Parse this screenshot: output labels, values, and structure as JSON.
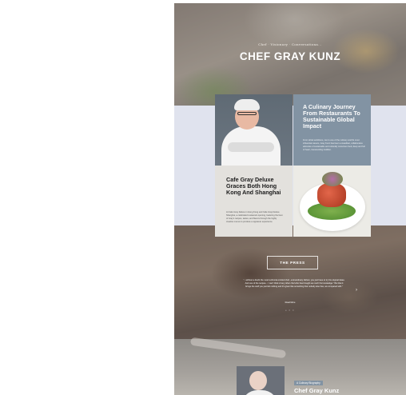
{
  "hero": {
    "tagline": "Chef · Visionary · Conversationa...",
    "title": "CHEF GRAY KUNZ"
  },
  "features": {
    "journey": {
      "title": "A Culinary Journey From Restaurants To Sustainable Global Impact",
      "body": "From whisk ambitions, can to one of the culinary world's most influential careers, Gray Kunz has been a steadfast, collaborative advocate of sustainable and culturally conscious food, deep and full of heart, transcending tradition."
    },
    "cafe": {
      "title": "Cafe Gray Deluxe Graces Both Hong Kong And Shanghai",
      "body": "At Cafe Gray Deluxe in Hong Kong and Cafe Gray Deluxe Shanghai, a celebrated restaurant opening, featuring the best of Gray's recipes, tastes, and flavors through the highly creative menus to produce a signature experience."
    }
  },
  "press": {
    "button_label": "THE PRESS",
    "quote": "\"...without a doubt the most technical-minded chef...extraordinary dishes; you just have to try his original ideas. And one of the recipes... I can't think of any other chef who has brought as much his knowledge.\" But that it brings the stuff you just felt nothing and it's given like something that nobody else has, we compared with.\"",
    "read_more": "Read More",
    "dots": "• ○ ○"
  },
  "bottom": {
    "label": "A Culinary Biography",
    "title": "Chef Gray Kunz"
  },
  "icons": {
    "arrow": "chevron-right-icon"
  },
  "colors": {
    "accent_blue": "#8293a3",
    "band": "#e0e3ee"
  }
}
